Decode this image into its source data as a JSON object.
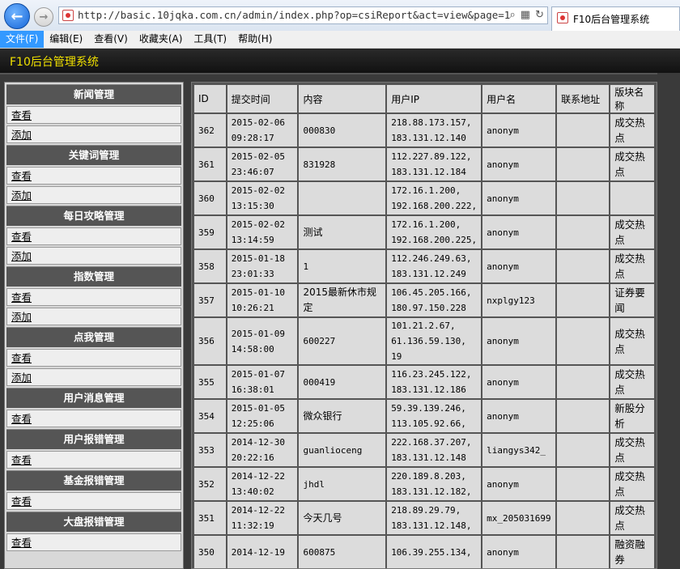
{
  "browser": {
    "url": "http://basic.10jqka.com.cn/admin/index.php?op=csiReport&act=view&page=1",
    "tab_title": "F10后台管理系统"
  },
  "menubar": {
    "items": [
      "文件(F)",
      "编辑(E)",
      "查看(V)",
      "收藏夹(A)",
      "工具(T)",
      "帮助(H)"
    ]
  },
  "app": {
    "title": "F10后台管理系统"
  },
  "sidebar": {
    "sections": [
      {
        "title": "新闻管理",
        "links": [
          "查看",
          "添加"
        ]
      },
      {
        "title": "关键词管理",
        "links": [
          "查看",
          "添加"
        ]
      },
      {
        "title": "每日攻略管理",
        "links": [
          "查看",
          "添加"
        ]
      },
      {
        "title": "指数管理",
        "links": [
          "查看",
          "添加"
        ]
      },
      {
        "title": "点我管理",
        "links": [
          "查看",
          "添加"
        ]
      },
      {
        "title": "用户消息管理",
        "links": [
          "查看"
        ]
      },
      {
        "title": "用户报错管理",
        "links": [
          "查看"
        ]
      },
      {
        "title": "基金报错管理",
        "links": [
          "查看"
        ]
      },
      {
        "title": "大盘报错管理",
        "links": [
          "查看"
        ]
      }
    ]
  },
  "table": {
    "headers": [
      "ID",
      "提交时间",
      "内容",
      "用户IP",
      "用户名",
      "联系地址",
      "版块名称"
    ],
    "rows": [
      {
        "id": "362",
        "time": "2015-02-06\n09:28:17",
        "content": "000830",
        "ip": "218.88.173.157,\n183.131.12.140",
        "user": "anonym",
        "addr": "",
        "section": "成交热点"
      },
      {
        "id": "361",
        "time": "2015-02-05\n23:46:07",
        "content": "831928",
        "ip": "112.227.89.122,\n183.131.12.184",
        "user": "anonym",
        "addr": "",
        "section": "成交热点"
      },
      {
        "id": "360",
        "time": "2015-02-02\n13:15:30",
        "content": "",
        "ip": "172.16.1.200,\n192.168.200.222,",
        "user": "anonym",
        "addr": "",
        "section": ""
      },
      {
        "id": "359",
        "time": "2015-02-02\n13:14:59",
        "content": "测试",
        "ip": "172.16.1.200,\n192.168.200.225,",
        "user": "anonym",
        "addr": "",
        "section": "成交热点"
      },
      {
        "id": "358",
        "time": "2015-01-18\n23:01:33",
        "content": "1",
        "ip": "112.246.249.63,\n183.131.12.249",
        "user": "anonym",
        "addr": "",
        "section": "成交热点"
      },
      {
        "id": "357",
        "time": "2015-01-10\n10:26:21",
        "content": "2015最新休市规定",
        "ip": "106.45.205.166,\n180.97.150.228",
        "user": "nxplgy123",
        "addr": "",
        "section": "证券要闻"
      },
      {
        "id": "356",
        "time": "2015-01-09\n14:58:00",
        "content": "600227",
        "ip": "101.21.2.67,\n61.136.59.130,\n19",
        "user": "anonym",
        "addr": "",
        "section": "成交热点"
      },
      {
        "id": "355",
        "time": "2015-01-07\n16:38:01",
        "content": "000419",
        "ip": "116.23.245.122,\n183.131.12.186",
        "user": "anonym",
        "addr": "",
        "section": "成交热点"
      },
      {
        "id": "354",
        "time": "2015-01-05\n12:25:06",
        "content": "微众银行",
        "ip": "59.39.139.246,\n113.105.92.66,",
        "user": "anonym",
        "addr": "",
        "section": "新股分析"
      },
      {
        "id": "353",
        "time": "2014-12-30\n20:22:16",
        "content": "guanlioceng",
        "ip": "222.168.37.207,\n183.131.12.148",
        "user": "liangys342_",
        "addr": "",
        "section": "成交热点"
      },
      {
        "id": "352",
        "time": "2014-12-22\n13:40:02",
        "content": "jhdl",
        "ip": "220.189.8.203,\n183.131.12.182,",
        "user": "anonym",
        "addr": "",
        "section": "成交热点"
      },
      {
        "id": "351",
        "time": "2014-12-22\n11:32:19",
        "content": "今天几号",
        "ip": "218.89.29.79,\n183.131.12.148,",
        "user": "mx_205031699",
        "addr": "",
        "section": "成交热点"
      },
      {
        "id": "350",
        "time": "2014-12-19\n",
        "content": "600875",
        "ip": "106.39.255.134,\n",
        "user": "anonym",
        "addr": "",
        "section": "融资融券"
      }
    ]
  }
}
